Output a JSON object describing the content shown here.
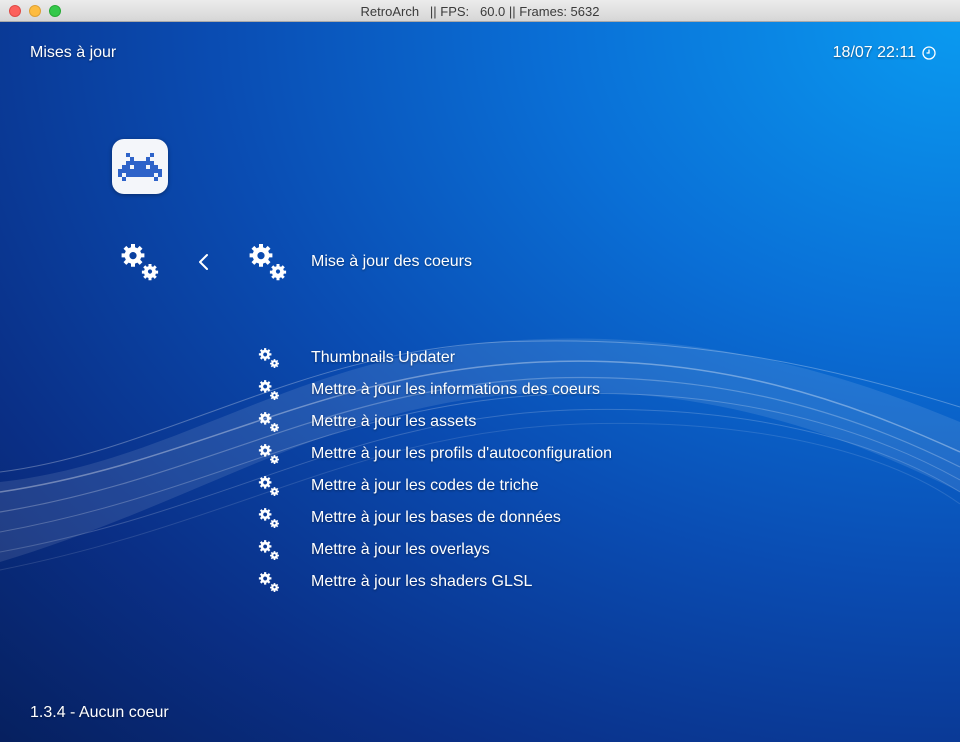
{
  "window": {
    "title": "RetroArch   || FPS:   60.0 || Frames: 5632"
  },
  "header": {
    "title": "Mises à jour",
    "clock": "18/07 22:11",
    "clock_icon": "clock-icon"
  },
  "sidebar": {
    "logo_icon": "retroarch-invader-logo",
    "category_icon": "settings-gears-icon",
    "back_icon": "chevron-left-icon"
  },
  "selected_item": {
    "label": "Mise à jour des coeurs",
    "icon": "settings-gears-icon"
  },
  "menu": {
    "items": [
      {
        "label": "Thumbnails Updater",
        "icon": "settings-gears-icon"
      },
      {
        "label": "Mettre à jour les informations des coeurs",
        "icon": "settings-gears-icon"
      },
      {
        "label": "Mettre à jour les assets",
        "icon": "settings-gears-icon"
      },
      {
        "label": "Mettre à jour les profils d'autoconfiguration",
        "icon": "settings-gears-icon"
      },
      {
        "label": "Mettre à jour les codes de triche",
        "icon": "settings-gears-icon"
      },
      {
        "label": "Mettre à jour les bases de données",
        "icon": "settings-gears-icon"
      },
      {
        "label": "Mettre à jour les overlays",
        "icon": "settings-gears-icon"
      },
      {
        "label": "Mettre à jour les shaders GLSL",
        "icon": "settings-gears-icon"
      }
    ]
  },
  "footer": {
    "version": "1.3.4 - Aucun coeur"
  },
  "colors": {
    "bg_light": "#0a9af0",
    "bg_dark": "#06205f",
    "text": "#ffffff",
    "logo_blue": "#2e63c9"
  }
}
